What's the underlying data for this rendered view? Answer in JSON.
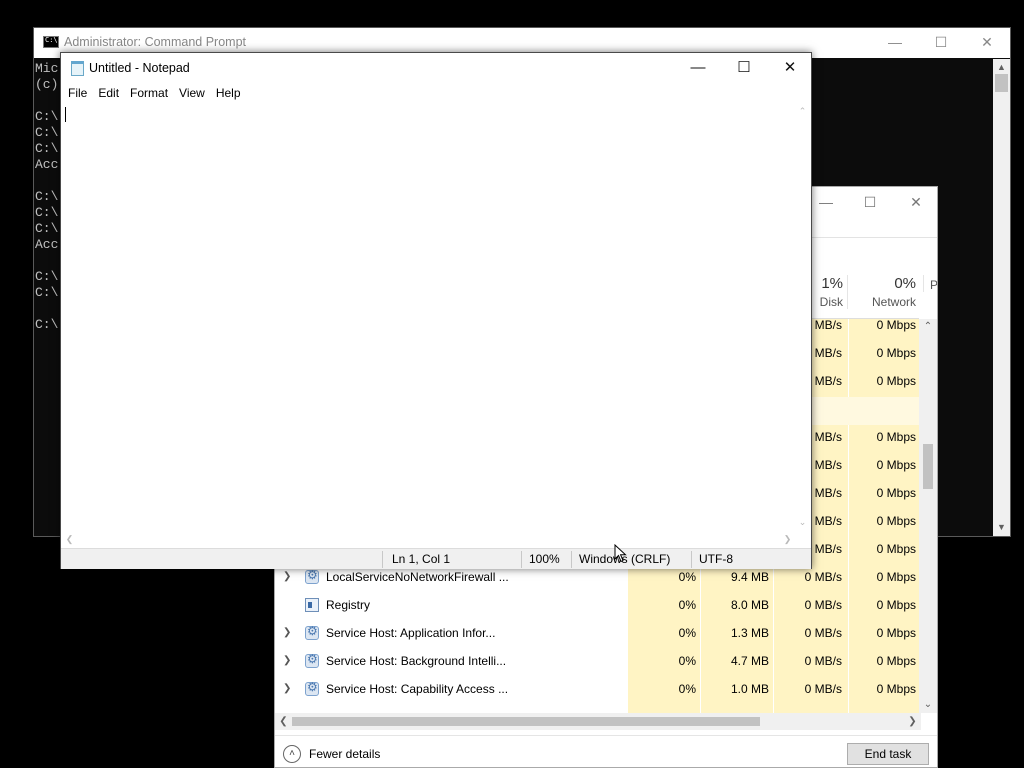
{
  "cmd": {
    "title": "Administrator: Command Prompt",
    "lines": [
      "Mic",
      "(c)",
      "",
      "C:\\",
      "C:\\",
      "C:\\",
      "Acc",
      "",
      "C:\\",
      "C:\\",
      "C:\\",
      "Acc",
      "",
      "C:\\",
      "C:\\",
      "",
      "C:\\"
    ]
  },
  "notepad": {
    "title": "Untitled - Notepad",
    "menu": [
      "File",
      "Edit",
      "Format",
      "View",
      "Help"
    ],
    "content": "",
    "status": {
      "position": "Ln 1, Col 1",
      "zoom": "100%",
      "line_ending": "Windows (CRLF)",
      "encoding": "UTF-8"
    }
  },
  "taskmanager": {
    "columns": [
      {
        "pct": "1%",
        "label": "Disk"
      },
      {
        "pct": "0%",
        "label": "Network"
      },
      {
        "pct": "",
        "label": "P"
      }
    ],
    "partial_rows": [
      {
        "disk": "MB/s",
        "network": "0 Mbps"
      },
      {
        "disk": "MB/s",
        "network": "0 Mbps"
      },
      {
        "disk": "MB/s",
        "network": "0 Mbps"
      },
      {
        "disk": "",
        "network": ""
      },
      {
        "disk": "MB/s",
        "network": "0 Mbps"
      },
      {
        "disk": "MB/s",
        "network": "0 Mbps"
      },
      {
        "disk": "MB/s",
        "network": "0 Mbps"
      },
      {
        "disk": "MB/s",
        "network": "0 Mbps"
      },
      {
        "disk": "MB/s",
        "network": "0 Mbps"
      }
    ],
    "rows": [
      {
        "name": "LocalServiceNoNetworkFirewall ...",
        "cpu": "0%",
        "memory": "9.4 MB",
        "disk": "0 MB/s",
        "network": "0 Mbps",
        "icon": "gear-icon",
        "expandable": true
      },
      {
        "name": "Registry",
        "cpu": "0%",
        "memory": "8.0 MB",
        "disk": "0 MB/s",
        "network": "0 Mbps",
        "icon": "registry-icon",
        "expandable": false
      },
      {
        "name": "Service Host: Application Infor...",
        "cpu": "0%",
        "memory": "1.3 MB",
        "disk": "0 MB/s",
        "network": "0 Mbps",
        "icon": "gear-icon",
        "expandable": true
      },
      {
        "name": "Service Host: Background Intelli...",
        "cpu": "0%",
        "memory": "4.7 MB",
        "disk": "0 MB/s",
        "network": "0 Mbps",
        "icon": "gear-icon",
        "expandable": true
      },
      {
        "name": "Service Host: Capability Access ...",
        "cpu": "0%",
        "memory": "1.0 MB",
        "disk": "0 MB/s",
        "network": "0 Mbps",
        "icon": "gear-icon",
        "expandable": true
      }
    ],
    "fewer_details": "Fewer details",
    "end_task": "End task"
  },
  "colors": {
    "heat_light": "#fff4c4",
    "heat_pale": "#fff9e0",
    "console_bg": "#0c0c0c",
    "console_text": "#c0c0c0"
  }
}
